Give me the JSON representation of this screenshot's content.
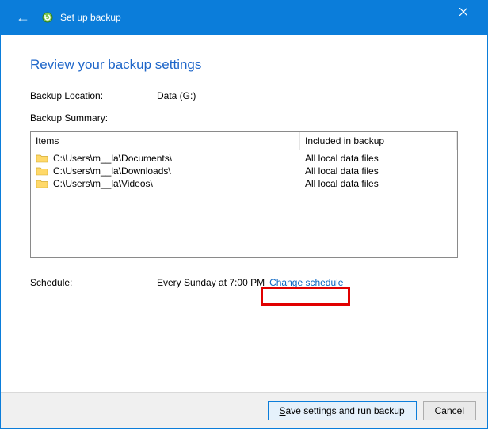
{
  "titlebar": {
    "title": "Set up backup"
  },
  "heading": "Review your backup settings",
  "backup_location": {
    "label": "Backup Location:",
    "value": "Data (G:)"
  },
  "backup_summary_label": "Backup Summary:",
  "list": {
    "header_items": "Items",
    "header_included": "Included in backup",
    "rows": [
      {
        "path": "C:\\Users\\m__la\\Documents\\",
        "included": "All local data files"
      },
      {
        "path": "C:\\Users\\m__la\\Downloads\\",
        "included": "All local data files"
      },
      {
        "path": "C:\\Users\\m__la\\Videos\\",
        "included": "All local data files"
      }
    ]
  },
  "schedule": {
    "label": "Schedule:",
    "value": "Every Sunday at 7:00 PM",
    "link": "Change schedule"
  },
  "footer": {
    "save": "Save settings and run backup",
    "cancel": "Cancel"
  }
}
